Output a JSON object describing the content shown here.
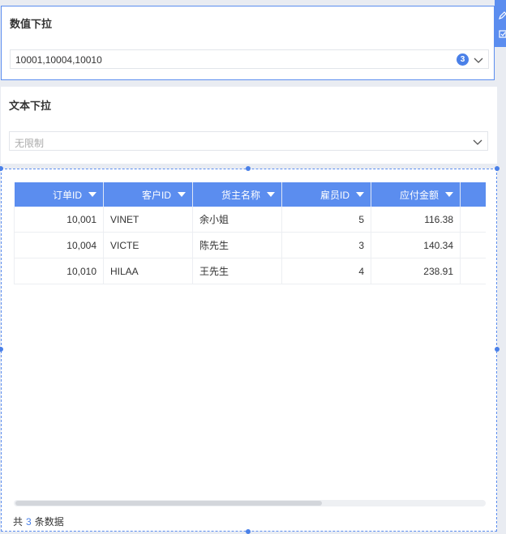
{
  "numeric_filter": {
    "title": "数值下拉",
    "value": "10001,10004,10010",
    "selected_count": "3"
  },
  "text_filter": {
    "title": "文本下拉",
    "placeholder": "无限制"
  },
  "table": {
    "columns": [
      "订单ID",
      "客户ID",
      "货主名称",
      "雇员ID",
      "应付金额",
      ""
    ],
    "rows": [
      [
        "10,001",
        "VINET",
        "余小姐",
        "5",
        "116.38",
        ""
      ],
      [
        "10,004",
        "VICTE",
        "陈先生",
        "3",
        "140.34",
        ""
      ],
      [
        "10,010",
        "HILAA",
        "王先生",
        "4",
        "238.91",
        ""
      ]
    ],
    "footer": {
      "prefix": "共",
      "count": "3",
      "suffix": "条数据"
    }
  },
  "colors": {
    "accent": "#5b8def",
    "badge": "#4a80e8"
  }
}
